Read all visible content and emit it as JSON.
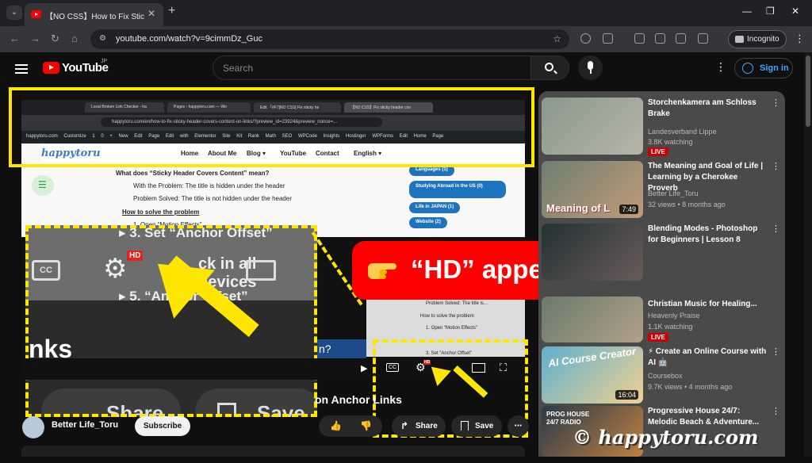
{
  "browser": {
    "tab_title": "【NO CSS】How to Fix Sticky He",
    "tab_close": "✕",
    "new_tab": "+",
    "win_min": "—",
    "win_max": "❐",
    "win_close": "✕",
    "url": "youtube.com/watch?v=9cimmDz_Guc",
    "incognito_label": "Incognito"
  },
  "yt": {
    "logo": "YouTube",
    "logo_region": "JP",
    "search_placeholder": "Search",
    "signin": "Sign in"
  },
  "inner_browser": {
    "tabs": [
      "Local Broken Link Checker - ha",
      "Pages ‹ happytoru.com — Wo",
      "Edit 「#F7]NO CSS] Fix sticky he",
      "【NO CSS】Fix sticky header cov"
    ],
    "url": "happytoru.com/en/how-to-fix-sticky-header-covers-content-on-links/?preview_id=23924&preview_nonce=...",
    "wp_bar": "happytoru.com  Customize  1  0  + New  Edit Page  Edit with Elementor  Site Kit  Rank Math SEO  WPCode  Insights  Hostinger  WPForms  Edit Home Page"
  },
  "site": {
    "brand": "happytoru",
    "nav": [
      "Home",
      "About Me",
      "Blog ▾",
      "YouTube",
      "Contact",
      "English ▾"
    ],
    "toc": [
      "What does “Sticky Header Covers Content” mean?",
      "With the Problem: The title is hidden under the header",
      "Problem Solved: The title is not hidden under the header",
      "How to solve the problem",
      "1. Open “Motion Effects”"
    ],
    "tags": [
      "Languages (1)",
      "Studying Abroad in the US (0)",
      "Life in JAPAN (1)",
      "Website (2)"
    ],
    "right_toc": [
      "Problem Solved: The title is...",
      "How to solve the problem",
      "1. Open “Motion Effects”",
      "2. Check in all devices",
      "3. Set “Anchor Offset”",
      "4. ...",
      "5. Set “Anchor Offset”"
    ],
    "fragment_question": "n?"
  },
  "zoom": {
    "line1": "▸ 3. Set “Anchor Offset”",
    "line2": "ck in all devices",
    "line3": "▸ 5.     “Anchor Offset”",
    "cc": "CC",
    "hd": "HD",
    "links_fragment": "nks",
    "share": "Share",
    "save": "Save"
  },
  "callout": {
    "text": "“HD” appears at 1080p"
  },
  "player": {
    "title": "on Anchor Links",
    "channel": "Better Life_Toru",
    "subscribe": "Subscribe",
    "share": "Share",
    "save": "Save",
    "more": "⋯",
    "hd": "HD"
  },
  "sidebar": {
    "items": [
      {
        "title": "Storchenkamera am Schloss Brake",
        "meta1": "Landesverband Lippe",
        "meta2": "3.8K watching",
        "live": "LIVE",
        "duration": ""
      },
      {
        "title": "The Meaning and Goal of Life | Learning by a Cherokee Proverb",
        "meta1": "Better Life_Toru",
        "meta2": "32 views • 8 months ago",
        "live": "",
        "duration": "7:49",
        "thumb_text": "Meaning of L"
      },
      {
        "title": "Blending Modes - Photoshop for Beginners | Lesson 8",
        "meta1": "",
        "meta2": "",
        "live": "",
        "duration": ""
      },
      {
        "title": "Christian Music for Healing...",
        "meta1": "Heavenly Praise",
        "meta2": "1.1K watching",
        "live": "LIVE",
        "duration": ""
      },
      {
        "title": "⚡ Create an Online Course with AI 🤖",
        "meta1": "Coursebox",
        "meta2": "9.7K views • 4 months ago",
        "live": "",
        "duration": "16:04",
        "thumb_text": "AI Course Creator"
      },
      {
        "title": "Progressive House 24/7: Melodic Beach & Adventure...",
        "meta1": "",
        "meta2": "",
        "live": "",
        "duration": "",
        "thumb_text": "PROG HOUSE 24/7 RADIO"
      }
    ]
  },
  "watermark": "© happytoru.com",
  "colors": {
    "highlight": "#ffe600",
    "callout": "#ff0000",
    "yt_red": "#ff0000"
  }
}
